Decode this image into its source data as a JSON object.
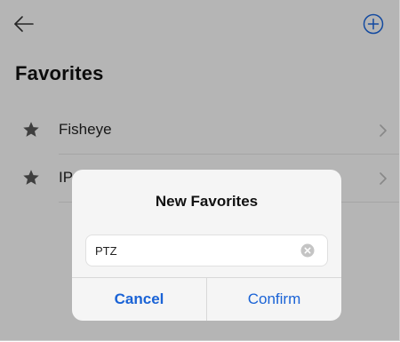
{
  "header": {
    "back_icon": "arrow-left-icon",
    "add_icon": "plus-circle-icon",
    "accent_color": "#1a63d6"
  },
  "page": {
    "title": "Favorites"
  },
  "favorites": [
    {
      "label": "Fisheye",
      "icon": "star-icon"
    },
    {
      "label": "IPC",
      "icon": "star-icon"
    }
  ],
  "dialog": {
    "title": "New Favorites",
    "input_value": "PTZ",
    "input_placeholder": "",
    "clear_icon": "clear-circle-icon",
    "cancel_label": "Cancel",
    "confirm_label": "Confirm"
  }
}
